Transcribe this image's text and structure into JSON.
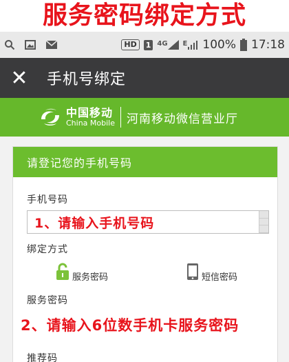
{
  "banner": {
    "title": "服务密码绑定方式"
  },
  "statusbar": {
    "left_icons": [
      "search-icon",
      "image-icon",
      "mail-icon"
    ],
    "hd": "HD",
    "sim": "1",
    "network": "4G",
    "network2": "E",
    "battery": "100%",
    "time": "17:18"
  },
  "navbar": {
    "close_glyph": "✕",
    "title": "手机号绑定"
  },
  "brand": {
    "logo_cn": "中国移动",
    "logo_en": "China Mobile",
    "hall_name": "河南移动微信营业厅",
    "color": "#66b82b"
  },
  "form": {
    "header": "请登记您的手机号码",
    "phone_label": "手机号码",
    "phone_placeholder": "1、请输入手机号码",
    "bind_label": "绑定方式",
    "bind_options": [
      {
        "label": "服务密码",
        "icon": "lock-icon",
        "selected": true
      },
      {
        "label": "短信密码",
        "icon": "phone-icon",
        "selected": false
      }
    ],
    "service_pwd_label": "服务密码",
    "service_pwd_hint": "2、请输入6位数手机卡服务密码",
    "referrer_label": "推荐码"
  },
  "colors": {
    "accent_red": "#e8141c",
    "green": "#6cbd2e",
    "nav_dark": "#3a3a3c"
  }
}
